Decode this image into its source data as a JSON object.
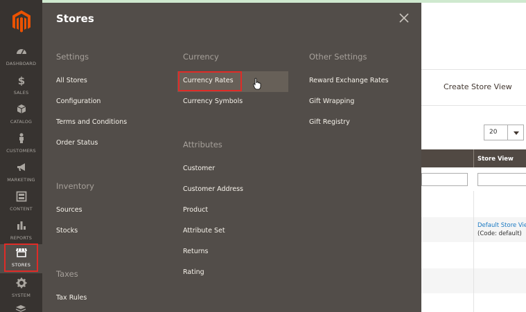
{
  "sidebar": {
    "items": [
      {
        "label": "DASHBOARD",
        "icon": "dashboard-icon"
      },
      {
        "label": "SALES",
        "icon": "dollar-icon"
      },
      {
        "label": "CATALOG",
        "icon": "box-icon"
      },
      {
        "label": "CUSTOMERS",
        "icon": "person-icon"
      },
      {
        "label": "MARKETING",
        "icon": "megaphone-icon"
      },
      {
        "label": "CONTENT",
        "icon": "layout-icon"
      },
      {
        "label": "REPORTS",
        "icon": "bar-chart-icon"
      },
      {
        "label": "STORES",
        "icon": "storefront-icon"
      },
      {
        "label": "SYSTEM",
        "icon": "gear-icon"
      }
    ],
    "active": "STORES"
  },
  "flyout": {
    "title": "Stores",
    "settings": {
      "heading": "Settings",
      "links": [
        "All Stores",
        "Configuration",
        "Terms and Conditions",
        "Order Status"
      ]
    },
    "inventory": {
      "heading": "Inventory",
      "links": [
        "Sources",
        "Stocks"
      ]
    },
    "taxes": {
      "heading": "Taxes",
      "links": [
        "Tax Rules"
      ]
    },
    "currency": {
      "heading": "Currency",
      "links": [
        "Currency Rates",
        "Currency Symbols"
      ]
    },
    "attributes": {
      "heading": "Attributes",
      "links": [
        "Customer",
        "Customer Address",
        "Product",
        "Attribute Set",
        "Returns",
        "Rating"
      ]
    },
    "other": {
      "heading": "Other Settings",
      "links": [
        "Reward Exchange Rates",
        "Gift Wrapping",
        "Gift Registry"
      ]
    }
  },
  "page": {
    "create_store_view": "Create Store View",
    "per_page": "20",
    "table_header": "Store View",
    "store_link": "Default Store View",
    "store_code": "(Code: default)"
  },
  "colors": {
    "sidebar_bg": "#373330",
    "flyout_bg": "#524d49",
    "highlight": "#e02b27",
    "brand_orange": "#eb5202"
  }
}
